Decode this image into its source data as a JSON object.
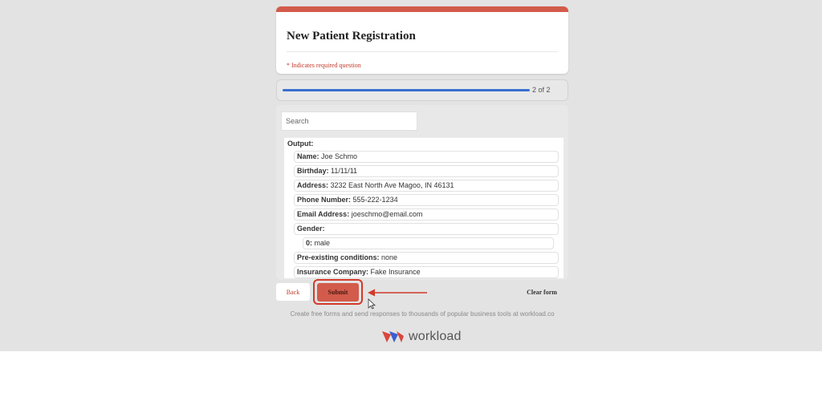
{
  "form": {
    "title": "New Patient Registration",
    "required_note": "* Indicates required question",
    "progress": {
      "text": "2 of 2",
      "fraction": 1.0
    },
    "search": {
      "placeholder": "Search",
      "value": ""
    },
    "output_label": "Output:",
    "fields": [
      {
        "key": "Name:",
        "value": "Joe Schmo"
      },
      {
        "key": "Birthday:",
        "value": "11/11/11"
      },
      {
        "key": "Address:",
        "value": "3232 East North Ave Magoo, IN 46131"
      },
      {
        "key": "Phone Number:",
        "value": "555-222-1234"
      },
      {
        "key": "Email Address:",
        "value": "joeschmo@email.com"
      },
      {
        "key": "Gender:",
        "value": ""
      },
      {
        "key": "0:",
        "value": "male"
      },
      {
        "key": "Pre-existing conditions:",
        "value": "none"
      },
      {
        "key": "Insurance Company:",
        "value": "Fake Insurance"
      }
    ],
    "nav": {
      "back_label": "Back",
      "submit_label": "Submit",
      "clear_label": "Clear form"
    }
  },
  "footer": {
    "note": "Create free forms and send responses to thousands of popular business tools at workload.co",
    "brand_name": "workload"
  },
  "colors": {
    "accent": "#d35b4b",
    "progress": "#3a6fd0",
    "highlight": "#d23a2a",
    "required_text": "#c0392b",
    "page_background": "#e3e3e3"
  },
  "icons": [
    "workload-logo-icon",
    "arrow-left-icon",
    "mouse-cursor-icon"
  ]
}
